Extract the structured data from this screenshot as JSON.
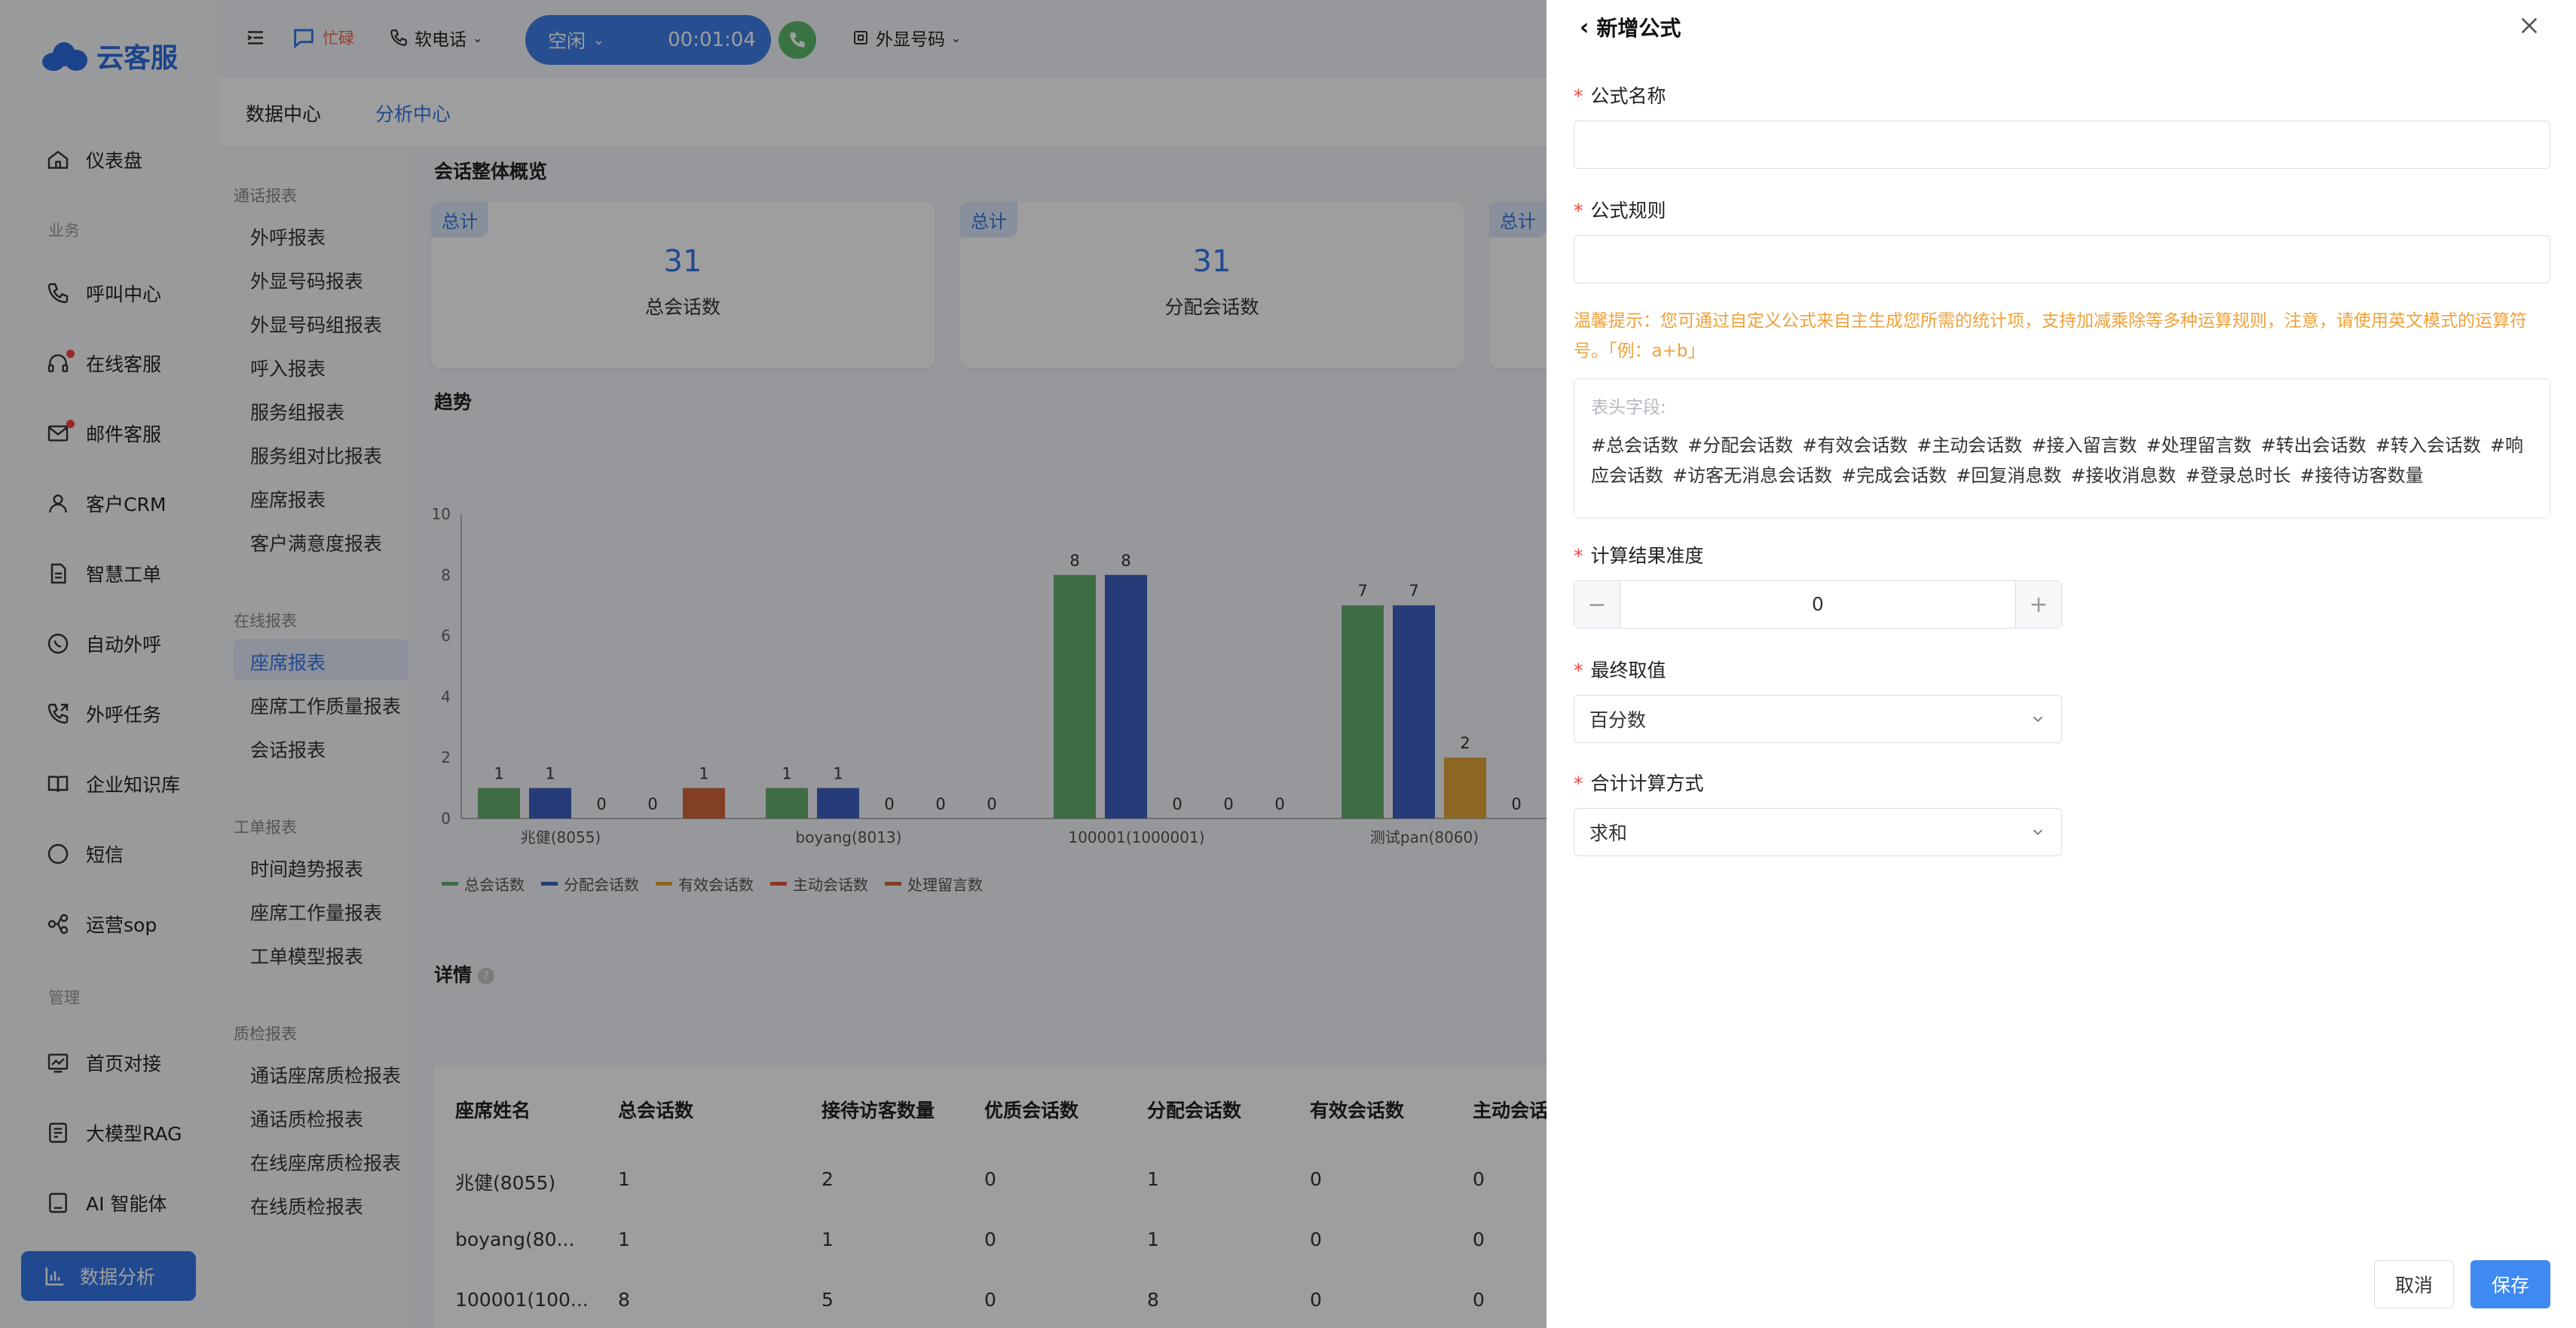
{
  "brand": {
    "name": "云客服",
    "accent": "#3677e8"
  },
  "sidebar": {
    "items": [
      {
        "label": "仪表盘",
        "icon": "home-icon"
      },
      {
        "label": "呼叫中心",
        "icon": "phone-icon"
      },
      {
        "label": "在线客服",
        "icon": "headset-icon"
      },
      {
        "label": "邮件客服",
        "icon": "mail-icon"
      },
      {
        "label": "客户CRM",
        "icon": "user-icon"
      },
      {
        "label": "智慧工单",
        "icon": "document-icon"
      },
      {
        "label": "自动外呼",
        "icon": "whatsapp-icon"
      },
      {
        "label": "外呼任务",
        "icon": "outbound-call-icon"
      },
      {
        "label": "企业知识库",
        "icon": "book-icon"
      },
      {
        "label": "短信",
        "icon": "sms-icon"
      },
      {
        "label": "运营sop",
        "icon": "flow-icon"
      },
      {
        "label": "首页对接",
        "icon": "chart-line-icon"
      },
      {
        "label": "大模型RAG",
        "icon": "model-icon"
      },
      {
        "label": "AI 智能体",
        "icon": "robot-icon"
      }
    ],
    "groups": {
      "business": "业务",
      "manage": "管理"
    },
    "active_item": "数据分析"
  },
  "topbar": {
    "busy_label": "忙碌",
    "softphone_label": "软电话",
    "status": "空闲",
    "timer": "00:01:04",
    "outbound_label": "外显号码"
  },
  "subtabs": [
    "数据中心",
    "分析中心"
  ],
  "report_menu": {
    "groups": [
      {
        "title": "通话报表",
        "items": [
          "外呼报表",
          "外显号码报表",
          "外显号码组报表",
          "呼入报表",
          "服务组报表",
          "服务组对比报表",
          "座席报表",
          "客户满意度报表"
        ]
      },
      {
        "title": "在线报表",
        "items": [
          "座席报表",
          "座席工作质量报表",
          "会话报表"
        ]
      },
      {
        "title": "工单报表",
        "items": [
          "时间趋势报表",
          "座席工作量报表",
          "工单模型报表"
        ]
      },
      {
        "title": "质检报表",
        "items": [
          "通话座席质检报表",
          "通话质检报表",
          "在线座席质检报表",
          "在线质检报表"
        ]
      }
    ],
    "active": "座席报表"
  },
  "overview": {
    "title": "会话整体概览",
    "cards": [
      {
        "badge": "总计",
        "value": "31",
        "label": "总会话数"
      },
      {
        "badge": "总计",
        "value": "31",
        "label": "分配会话数"
      },
      {
        "badge": "总计",
        "value": "",
        "label": ""
      }
    ]
  },
  "trend_title": "趋势",
  "chart_data": {
    "type": "bar",
    "categories": [
      "兆健(8055)",
      "boyang(8013)",
      "100001(1000001)",
      "测试pan(8060)"
    ],
    "series": [
      {
        "name": "总会话数",
        "color": "#67b06c",
        "values": [
          1,
          1,
          8,
          7
        ]
      },
      {
        "name": "分配会话数",
        "color": "#3e62c4",
        "values": [
          1,
          1,
          8,
          7
        ]
      },
      {
        "name": "有效会话数",
        "color": "#e3a73a",
        "values": [
          0,
          0,
          0,
          2
        ]
      },
      {
        "name": "主动会话数",
        "color": "#e05a34",
        "values": [
          0,
          0,
          0,
          0
        ]
      },
      {
        "name": "处理留言数",
        "color": "#d4663a",
        "values": [
          1,
          0,
          0,
          null
        ]
      }
    ],
    "ylim": [
      0,
      10
    ],
    "yticks": [
      0,
      2,
      4,
      6,
      8,
      10
    ]
  },
  "detail": {
    "title": "详情",
    "columns": [
      "座席姓名",
      "总会话数",
      "接待访客数量",
      "优质会话数",
      "分配会话数",
      "有效会话数",
      "主动会话"
    ],
    "rows": [
      [
        "兆健(8055)",
        "1",
        "2",
        "0",
        "1",
        "0",
        "0"
      ],
      [
        "boyang(80...",
        "1",
        "1",
        "0",
        "1",
        "0",
        "0"
      ],
      [
        "100001(100...",
        "8",
        "5",
        "0",
        "8",
        "0",
        "0"
      ]
    ]
  },
  "drawer": {
    "title": "新增公式",
    "name_label": "公式名称",
    "name_value": "",
    "rule_label": "公式规则",
    "rule_value": "",
    "tip": "温馨提示：您可通过自定义公式来自主生成您所需的统计项，支持加减乘除等多种运算规则，注意，请使用英文模式的运算符号。「例：a+b」",
    "fields_placeholder": "表头字段:",
    "fields": [
      "#总会话数",
      "#分配会话数",
      "#有效会话数",
      "#主动会话数",
      "#接入留言数",
      "#处理留言数",
      "#转出会话数",
      "#转入会话数",
      "#响应会话数",
      "#访客无消息会话数",
      "#完成会话数",
      "#回复消息数",
      "#接收消息数",
      "#登录总时长",
      "#接待访客数量"
    ],
    "precision_label": "计算结果准度",
    "precision_value": "0",
    "final_label": "最终取值",
    "final_value": "百分数",
    "sum_label": "合计计算方式",
    "sum_value": "求和",
    "cancel": "取消",
    "save": "保存"
  }
}
